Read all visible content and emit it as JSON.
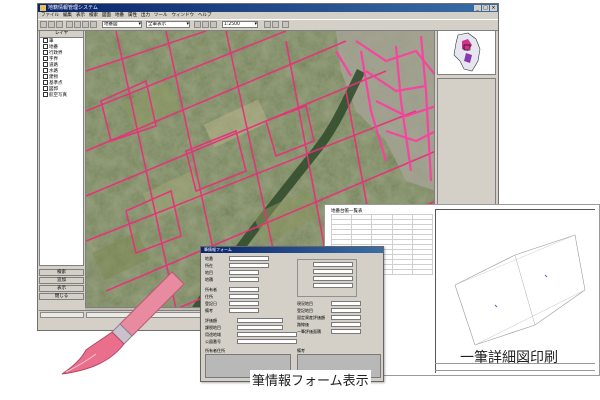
{
  "app": {
    "title": "地籍情報管理システム",
    "menu": [
      "ファイル",
      "編集",
      "表示",
      "検索",
      "図面",
      "地番",
      "属性",
      "出力",
      "ツール",
      "ウィンドウ",
      "ヘルプ"
    ],
    "combo1": "地番図",
    "combo2": "全筆表示",
    "combo3": "1:2500"
  },
  "layers": {
    "header": "レイヤ",
    "items": [
      "筆",
      "地番",
      "行政界",
      "字界",
      "道路",
      "水路",
      "建物",
      "基準点",
      "図郭",
      "航空写真"
    ]
  },
  "left_buttons": [
    "検索",
    "追加",
    "表示",
    "閉じる"
  ],
  "report": {
    "title": "地番台帳一覧表",
    "rows": 12
  },
  "form": {
    "title": "筆情報フォーム",
    "fields": [
      "地番",
      "所在",
      "地目",
      "地積",
      "所有者",
      "住所",
      "登記日",
      "備考",
      "評価額",
      "課税地目",
      "用途地域",
      "公図番号"
    ],
    "right_fields": [
      "現況地目",
      "登記地目",
      "固定資産評価額",
      "路線価",
      "一筆評価面積"
    ],
    "note_left": "所有者住所",
    "note_right": "備考"
  },
  "captions": {
    "form": "筆情報フォーム表示",
    "print": "一筆詳細図印刷"
  },
  "colors": {
    "parcel_line": "#e8307a",
    "brush_pink": "#e88aa0"
  }
}
